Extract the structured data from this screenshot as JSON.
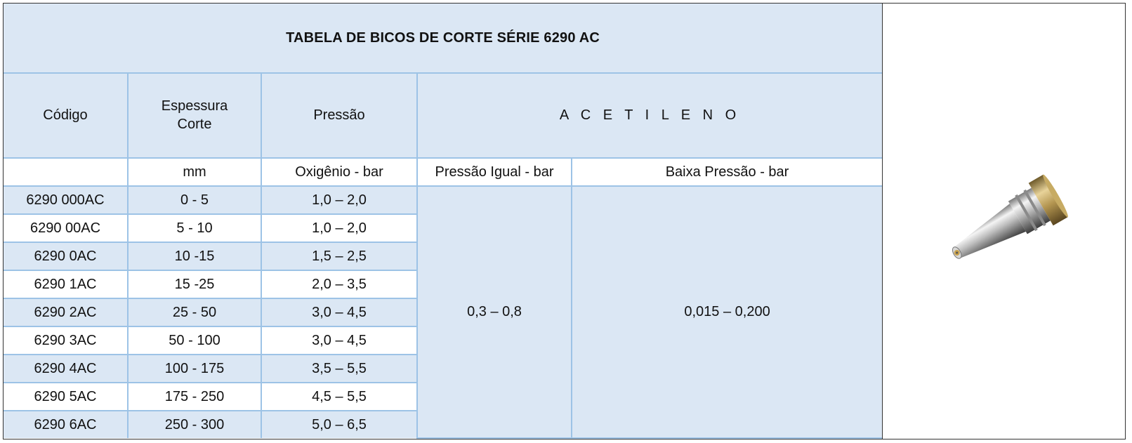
{
  "title": "TABELA DE BICOS DE CORTE SÉRIE 6290 AC",
  "header": {
    "codigo": "Código",
    "espessura_l1": "Espessura",
    "espessura_l2": "Corte",
    "pressao": "Pressão",
    "acetileno": "A C E T I L E N O"
  },
  "units": {
    "codigo": "",
    "espessura": "mm",
    "oxigenio": "Oxigênio - bar",
    "pressao_igual": "Pressão Igual - bar",
    "baixa_pressao": "Baixa Pressão - bar"
  },
  "rows": [
    {
      "codigo": "6290 000AC",
      "espessura": "0 - 5",
      "oxigenio": "1,0 – 2,0"
    },
    {
      "codigo": "6290 00AC",
      "espessura": "5 - 10",
      "oxigenio": "1,0 – 2,0"
    },
    {
      "codigo": "6290 0AC",
      "espessura": "10 -15",
      "oxigenio": "1,5 – 2,5"
    },
    {
      "codigo": "6290 1AC",
      "espessura": "15 -25",
      "oxigenio": "2,0 – 3,5"
    },
    {
      "codigo": "6290 2AC",
      "espessura": "25 - 50",
      "oxigenio": "3,0 – 4,5"
    },
    {
      "codigo": "6290 3AC",
      "espessura": "50 - 100",
      "oxigenio": "3,0 – 4,5"
    },
    {
      "codigo": "6290 4AC",
      "espessura": "100 - 175",
      "oxigenio": "3,5 – 5,5"
    },
    {
      "codigo": "6290 5AC",
      "espessura": "175 - 250",
      "oxigenio": "4,5 – 5,5"
    },
    {
      "codigo": "6290 6AC",
      "espessura": "250 - 300",
      "oxigenio": "5,0 – 6,5"
    }
  ],
  "acetileno_values": {
    "pressao_igual": "0,3 – 0,8",
    "baixa_pressao": "0,015 – 0,200"
  },
  "colors": {
    "light_blue": "#dbe7f4",
    "border_blue": "#9dc3e6"
  },
  "image": {
    "subject": "cutting-nozzle-photo"
  }
}
